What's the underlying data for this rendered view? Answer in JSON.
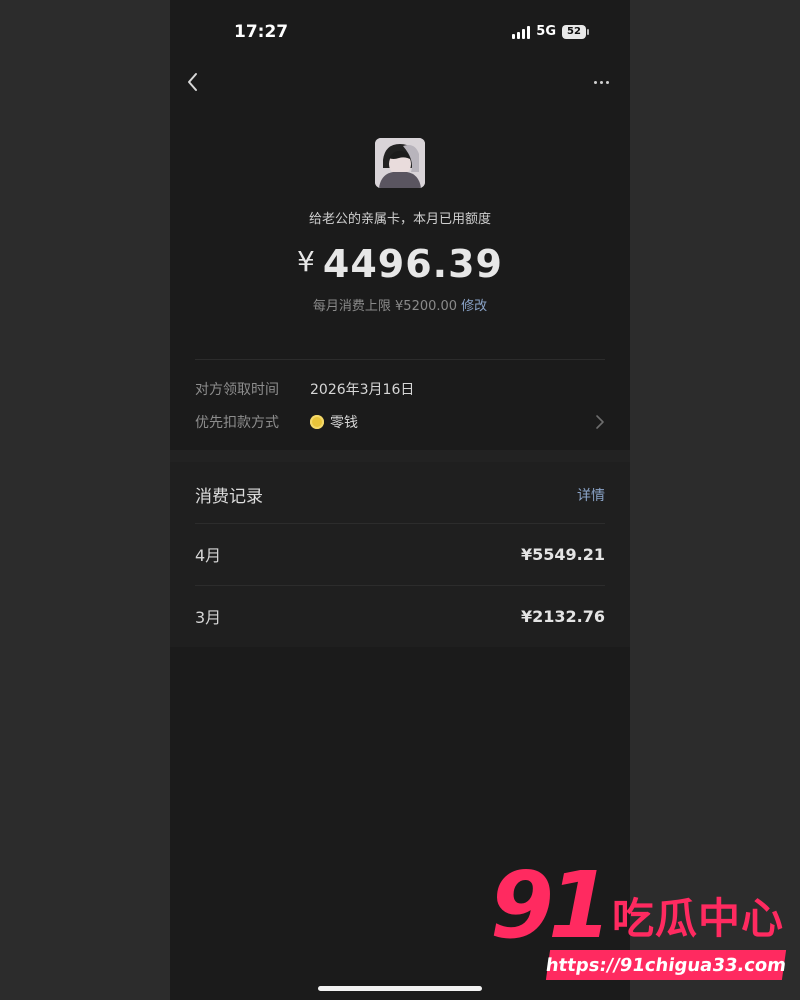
{
  "status_bar": {
    "time": "17:27",
    "network": "5G",
    "battery": "52"
  },
  "nav": {
    "back_icon": "chevron-left-icon",
    "more_icon": "more-horizontal-icon"
  },
  "card": {
    "title": "给老公的亲属卡，本月已用额度",
    "currency_symbol": "¥",
    "used_amount": "4496.39",
    "limit_text": "每月消费上限 ¥5200.00",
    "edit_label": "修改"
  },
  "info": {
    "claim_time_label": "对方领取时间",
    "claim_time_value": "2026年3月16日",
    "payment_label": "优先扣款方式",
    "payment_value": "零钱",
    "payment_icon": "coin-icon"
  },
  "records": {
    "title": "消费记录",
    "detail_label": "详情",
    "rows": [
      {
        "month": "4月",
        "amount": "¥5549.21"
      },
      {
        "month": "3月",
        "amount": "¥2132.76"
      }
    ]
  },
  "watermark": {
    "number": "91",
    "name": "吃瓜中心",
    "url": "https://91chigua33.com"
  },
  "colors": {
    "accent_link": "#8aa3c7",
    "watermark": "#ff2a60",
    "background": "#1b1b1b"
  }
}
